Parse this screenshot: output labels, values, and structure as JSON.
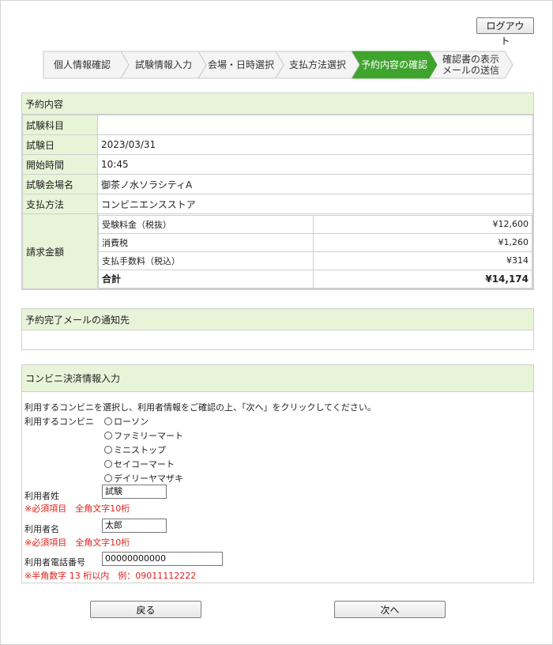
{
  "logout_label": "ログアウト",
  "steps": [
    {
      "label": "個人情報確認",
      "active": false
    },
    {
      "label": "試験情報入力",
      "active": false
    },
    {
      "label": "会場・日時選択",
      "active": false
    },
    {
      "label": "支払方法選択",
      "active": false
    },
    {
      "label": "予約内容の確認",
      "active": true
    },
    {
      "label": "確認書の表示\nメールの送信",
      "active": false
    }
  ],
  "colors": {
    "step_bg": "#f4f4f4",
    "step_active": "#3fa42e",
    "section_bg": "#e8f4d8",
    "note_red": "#e0201a"
  },
  "reservation": {
    "title": "予約内容",
    "rows": [
      {
        "label": "試験科目",
        "value": ""
      },
      {
        "label": "試験日",
        "value": "2023/03/31"
      },
      {
        "label": "開始時間",
        "value": "10:45"
      },
      {
        "label": "試験会場名",
        "value": "御茶ノ水ソラシティA"
      },
      {
        "label": "支払方法",
        "value": "コンビニエンスストア"
      }
    ],
    "billing_label": "請求金額",
    "billing": [
      {
        "item": "受験料金（税抜）",
        "amount": "¥12,600"
      },
      {
        "item": "消費税",
        "amount": "¥1,260"
      },
      {
        "item": "支払手数料（税込）",
        "amount": "¥314"
      },
      {
        "item": "合計",
        "amount": "¥14,174"
      }
    ]
  },
  "email_section": {
    "title": "予約完了メールの通知先",
    "value": ""
  },
  "convenience": {
    "title": "コンビニ決済情報入力",
    "instruction": "利用するコンビニを選択し、利用者情報をご確認の上、「次へ」をクリックしてください。",
    "store_label": "利用するコンビニ",
    "stores": [
      "ローソン",
      "ファミリーマート",
      "ミニストップ",
      "セイコーマート",
      "デイリーヤマザキ"
    ],
    "last_name_label": "利用者姓",
    "last_name_value": "試験",
    "last_name_note": "※必須項目　全角文字10桁",
    "first_name_label": "利用者名",
    "first_name_value": "太郎",
    "first_name_note": "※必須項目　全角文字10桁",
    "phone_label": "利用者電話番号",
    "phone_value": "00000000000",
    "phone_note": "※半角数字 13 桁以内　例：09011112222"
  },
  "back_label": "戻る",
  "next_label": "次へ"
}
